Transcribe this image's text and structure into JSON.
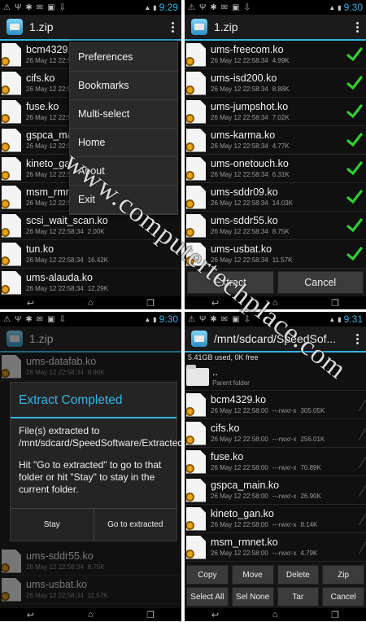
{
  "watermark": "www.computertechplace.com",
  "colors": {
    "accent": "#33b5e5",
    "check": "#33cc33",
    "background": "#101010"
  },
  "panels": [
    {
      "status_time": "9:29",
      "title": "1.zip",
      "files": [
        {
          "name": "bcm4329.ko",
          "date": "26 May 12 22:58:34",
          "size": ""
        },
        {
          "name": "cifs.ko",
          "date": "26 May 12 22:58:34",
          "size": ""
        },
        {
          "name": "fuse.ko",
          "date": "26 May 12 22:58:34",
          "size": ""
        },
        {
          "name": "gspca_main.ko",
          "date": "26 May 12 22:58:34",
          "size": ""
        },
        {
          "name": "kineto_gan.ko",
          "date": "26 May 12 22:58:34",
          "size": ""
        },
        {
          "name": "msm_rmnet.ko",
          "date": "26 May 12 22:58:34",
          "size": ""
        },
        {
          "name": "scsi_wait_scan.ko",
          "date": "26 May 12 22:58:34",
          "size": "2.00K"
        },
        {
          "name": "tun.ko",
          "date": "26 May 12 22:58:34",
          "size": "16.42K"
        },
        {
          "name": "ums-alauda.ko",
          "date": "26 May 12 22:58:34",
          "size": "12.29K"
        }
      ],
      "menu": [
        "Preferences",
        "Bookmarks",
        "Multi-select",
        "Home",
        "About",
        "Exit"
      ]
    },
    {
      "status_time": "9:30",
      "title": "1.zip",
      "files": [
        {
          "name": "ums-freecom.ko",
          "date": "26 May 12 22:58:34",
          "size": "4.99K"
        },
        {
          "name": "ums-isd200.ko",
          "date": "26 May 12 22:58:34",
          "size": "8.88K"
        },
        {
          "name": "ums-jumpshot.ko",
          "date": "26 May 12 22:58:34",
          "size": "7.02K"
        },
        {
          "name": "ums-karma.ko",
          "date": "26 May 12 22:58:34",
          "size": "4.77K"
        },
        {
          "name": "ums-onetouch.ko",
          "date": "26 May 12 22:58:34",
          "size": "6.31K"
        },
        {
          "name": "ums-sddr09.ko",
          "date": "26 May 12 22:58:34",
          "size": "14.03K"
        },
        {
          "name": "ums-sddr55.ko",
          "date": "26 May 12 22:58:34",
          "size": "8.75K"
        },
        {
          "name": "ums-usbat.ko",
          "date": "26 May 12 22:58:34",
          "size": "11.57K"
        }
      ],
      "buttons": {
        "extract": "Extract",
        "cancel": "Cancel"
      }
    },
    {
      "status_time": "9:30",
      "title": "1.zip",
      "files_top": [
        {
          "name": "ums-datafab.ko",
          "date": "26 May 12 22:58:34",
          "size": "8.96K"
        }
      ],
      "files_bottom": [
        {
          "name": "ums-sddr55.ko",
          "date": "26 May 12 22:58:34",
          "size": "8.75K"
        },
        {
          "name": "ums-usbat.ko",
          "date": "26 May 12 22:58:34",
          "size": "11.57K"
        }
      ],
      "dialog": {
        "title": "Extract Completed",
        "message1": "File(s) extracted to /mnt/sdcard/SpeedSoftware/Extracted.",
        "message2": "Hit \"Go to extracted\" to go to that folder or hit \"Stay\" to stay in the current folder.",
        "stay": "Stay",
        "go": "Go to extracted"
      }
    },
    {
      "status_time": "9:31",
      "title": "/mnt/sdcard/SpeedSof...",
      "usage": "5.41GB used, 0K free",
      "parent": {
        "name": "..",
        "label": "Parent folder"
      },
      "files": [
        {
          "name": "bcm4329.ko",
          "date": "26 May 12 22:58:00",
          "perm": "---rwxr-x",
          "size": "305.05K"
        },
        {
          "name": "cifs.ko",
          "date": "26 May 12 22:58:00",
          "perm": "---rwxr-x",
          "size": "256.01K"
        },
        {
          "name": "fuse.ko",
          "date": "26 May 12 22:58:00",
          "perm": "---rwxr-x",
          "size": "70.89K"
        },
        {
          "name": "gspca_main.ko",
          "date": "26 May 12 22:58:00",
          "perm": "---rwxr-x",
          "size": "26.90K"
        },
        {
          "name": "kineto_gan.ko",
          "date": "26 May 12 22:58:00",
          "perm": "---rwxr-x",
          "size": "8.14K"
        },
        {
          "name": "msm_rmnet.ko",
          "date": "26 May 12 22:58:00",
          "perm": "---rwxr-x",
          "size": "4.79K"
        }
      ],
      "buttons": [
        "Copy",
        "Move",
        "Delete",
        "Zip",
        "Select All",
        "Sel None",
        "Tar",
        "Cancel"
      ]
    }
  ]
}
